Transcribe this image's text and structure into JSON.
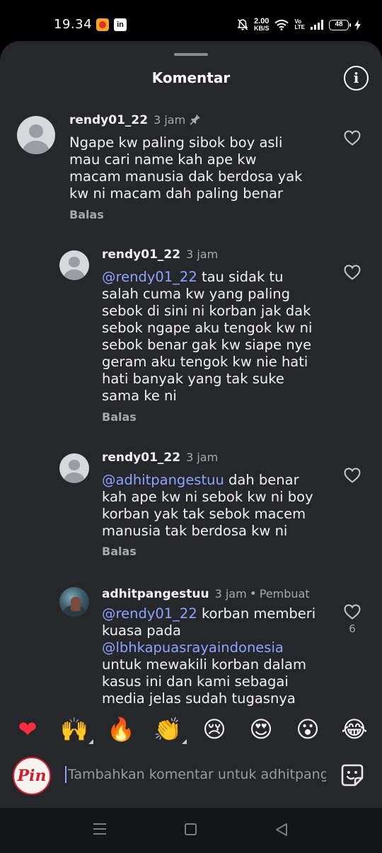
{
  "status_bar": {
    "time": "19.34",
    "app_icon_2": "in",
    "speed_value": "2.00",
    "speed_unit": "KB/S",
    "volte_top": "Vo",
    "volte_bottom": "LTE",
    "battery": "48",
    "icons": [
      "notification-app-icon",
      "linkedin-icon",
      "mute-bell-icon",
      "wifi-icon",
      "signal-icon",
      "battery-icon",
      "charging-icon"
    ]
  },
  "sheet": {
    "title": "Komentar",
    "info_icon": "info-icon"
  },
  "comments": [
    {
      "username": "rendy01_22",
      "time": "3 jam",
      "pinned": true,
      "parts": [
        {
          "text": "Ngape kw paling sibok boy asli mau cari name kah ape kw macam manusia dak berdosa yak kw ni macam dah paling benar",
          "mention": false
        }
      ],
      "reply_label": "Balas"
    },
    {
      "username": "rendy01_22",
      "time": "3 jam",
      "parts": [
        {
          "text": "@rendy01_22",
          "mention": true
        },
        {
          "text": " tau sidak tu salah cuma kw yang paling sebok di sini ni korban jak dak sebok ngape aku tengok kw ni sebok benar gak kw siape nye geram aku tengok kw nie hati hati banyak yang tak suke sama ke ni",
          "mention": false
        }
      ],
      "reply_label": "Balas"
    },
    {
      "username": "rendy01_22",
      "time": "3 jam",
      "parts": [
        {
          "text": "@adhitpangestuu",
          "mention": true
        },
        {
          "text": " dah benar kah ape kw ni sebok kw ni boy korban yak tak sebok macem manusia tak berdosa kw ni",
          "mention": false
        }
      ],
      "reply_label": "Balas"
    },
    {
      "username": "adhitpangestuu",
      "time": "3 jam",
      "author_label": "Pembuat",
      "like_count": "6",
      "parts": [
        {
          "text": "@rendy01_22",
          "mention": true
        },
        {
          "text": " korban memberi kuasa pada ",
          "mention": false
        },
        {
          "text": "@lbhkapuasrayaindonesia",
          "mention": true
        },
        {
          "text": " untuk mewakili korban dalam kasus ini dan kami sebagai media jelas sudah tugasnya menggedor",
          "mention": false
        }
      ]
    }
  ],
  "emoji_bar": [
    "❤",
    "🙌",
    "🔥",
    "👏",
    "😢",
    "😍",
    "😮",
    "😂"
  ],
  "input": {
    "placeholder": "Tambahkan komentar untuk adhitpangestuu...",
    "avatar_text": "Pin",
    "sticker_icon": "sticker-icon"
  },
  "colors": {
    "sheet_bg": "#25272a",
    "mention": "#8fa4ff",
    "secondary_text": "#a8a9ad"
  }
}
